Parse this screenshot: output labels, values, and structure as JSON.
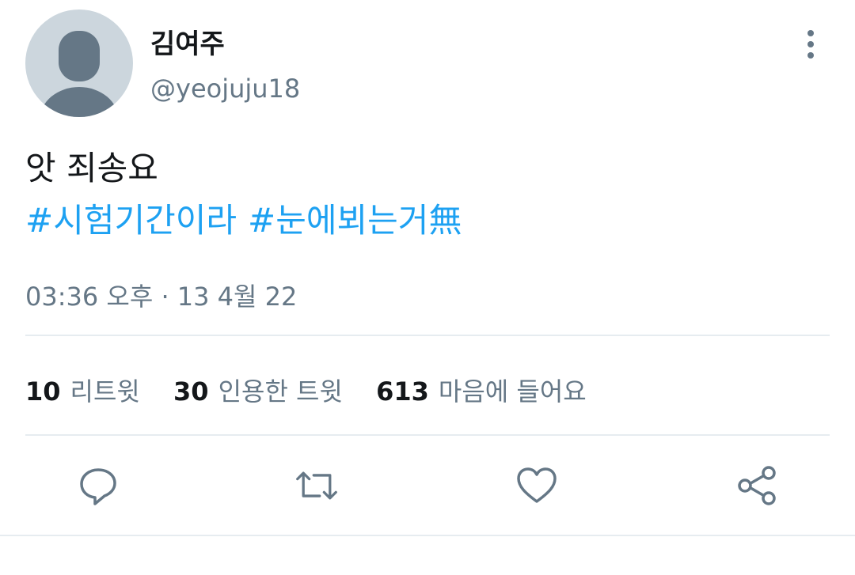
{
  "tweet": {
    "display_name": "김여주",
    "handle": "@yeojuju18",
    "text": "앗 죄송요",
    "hashtags": [
      "#시험기간이라",
      "#눈에뵈는거無"
    ],
    "timestamp": "03:36 오후 · 13 4월 22"
  },
  "stats": {
    "retweets": {
      "count": "10",
      "label": "리트윗"
    },
    "quotes": {
      "count": "30",
      "label": "인용한 트윗"
    },
    "likes": {
      "count": "613",
      "label": "마음에 들어요"
    }
  },
  "icons": {
    "avatar": "default-avatar-icon",
    "more": "more-vertical-icon",
    "reply": "reply-icon",
    "retweet": "retweet-icon",
    "like": "heart-icon",
    "share": "share-icon"
  },
  "colors": {
    "hashtag": "#1da1f2",
    "secondary_text": "#657786",
    "primary_text": "#14171a",
    "divider": "#e6ecf0"
  }
}
